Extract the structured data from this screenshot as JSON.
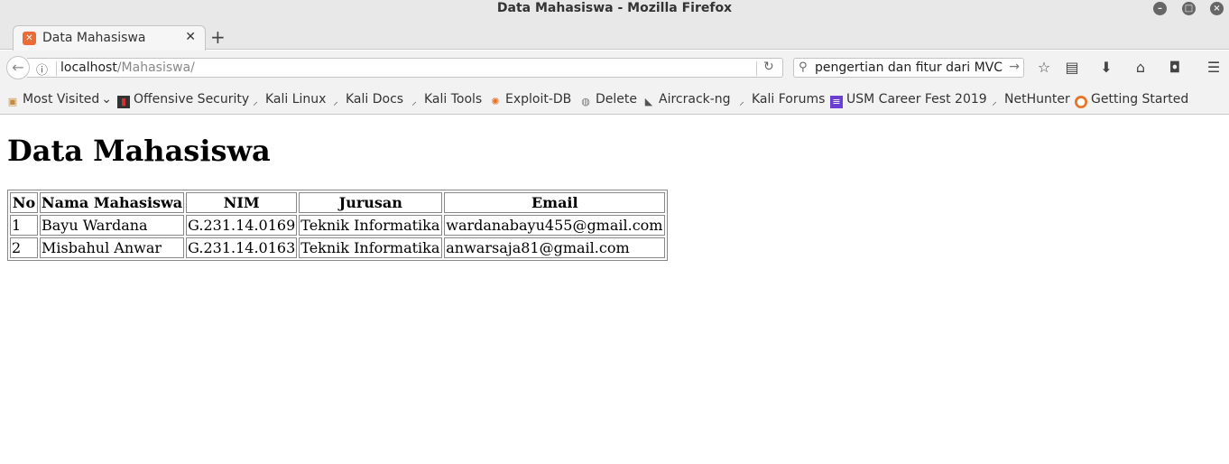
{
  "window": {
    "title": "Data Mahasiswa - Mozilla Firefox"
  },
  "tabs": [
    {
      "label": "Data Mahasiswa",
      "favicon": "xampp-icon"
    }
  ],
  "navbar": {
    "url_host": "localhost",
    "url_path": "/Mahasiswa/",
    "search_value": "pengertian dan fitur dari MVC"
  },
  "bookmarks": [
    {
      "label": "Most Visited",
      "icon": "folder-icon"
    },
    {
      "label": "Offensive Security",
      "icon": "offsec-icon"
    },
    {
      "label": "Kali Linux",
      "icon": "kali-icon"
    },
    {
      "label": "Kali Docs",
      "icon": "kali-icon"
    },
    {
      "label": "Kali Tools",
      "icon": "kali-icon"
    },
    {
      "label": "Exploit-DB",
      "icon": "exploitdb-icon"
    },
    {
      "label": "Delete",
      "icon": "globe-icon"
    },
    {
      "label": "Aircrack-ng",
      "icon": "aircrack-icon"
    },
    {
      "label": "Kali Forums",
      "icon": "kali-icon"
    },
    {
      "label": "USM Career Fest 2019",
      "icon": "form-icon"
    },
    {
      "label": "NetHunter",
      "icon": "kali-icon"
    },
    {
      "label": "Getting Started",
      "icon": "firefox-icon"
    }
  ],
  "page": {
    "heading": "Data Mahasiswa",
    "table": {
      "headers": [
        "No",
        "Nama Mahasiswa",
        "NIM",
        "Jurusan",
        "Email"
      ],
      "rows": [
        [
          "1",
          "Bayu Wardana",
          "G.231.14.0169",
          "Teknik Informatika",
          "wardanabayu455@gmail.com"
        ],
        [
          "2",
          "Misbahul Anwar",
          "G.231.14.0163",
          "Teknik Informatika",
          "anwarsaja81@gmail.com"
        ]
      ]
    }
  },
  "colors": {
    "chrome": "#f2f2f2",
    "titlebar": "#e8e8e8",
    "xampp_orange": "#ea6c36",
    "form_purple": "#6a3fd1",
    "firefox_orange": "#e8742a"
  }
}
